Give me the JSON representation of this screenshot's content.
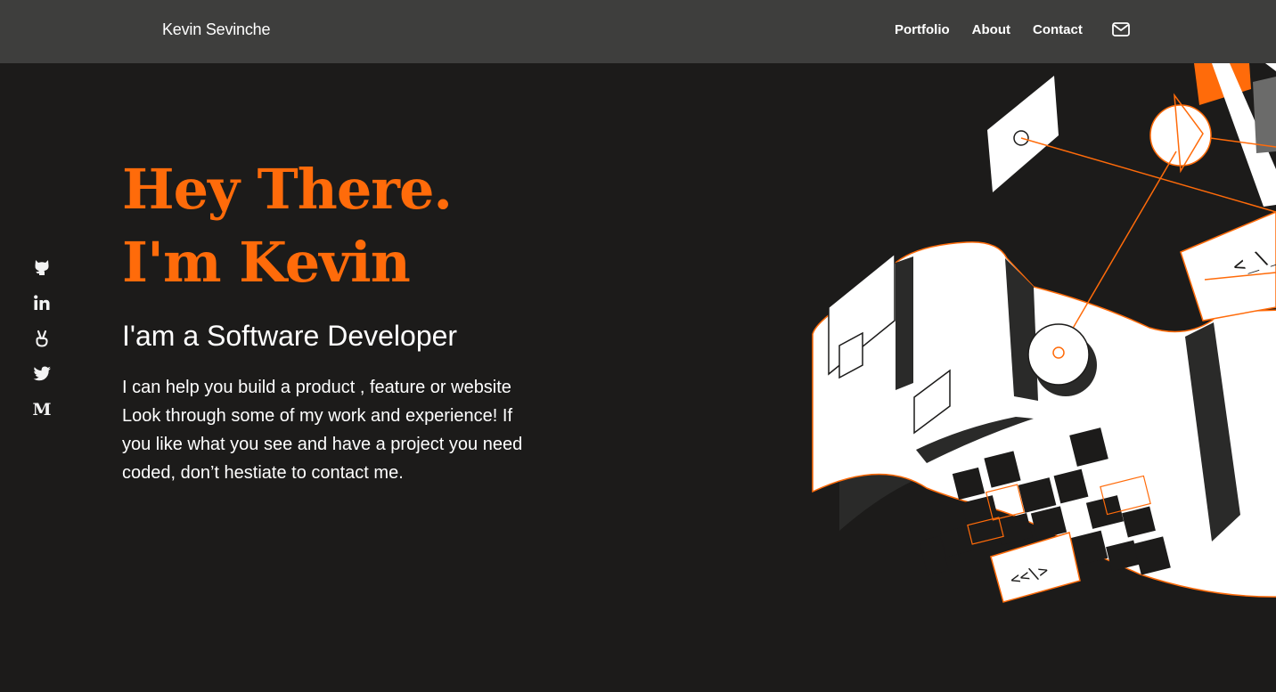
{
  "header": {
    "brand": "Kevin Sevinche",
    "nav": [
      {
        "label": "Portfolio"
      },
      {
        "label": "About"
      },
      {
        "label": "Contact"
      }
    ],
    "mail_icon": "mail-icon"
  },
  "social": [
    {
      "icon": "github-icon"
    },
    {
      "icon": "linkedin-icon"
    },
    {
      "icon": "angellist-icon"
    },
    {
      "icon": "twitter-icon"
    },
    {
      "icon": "medium-icon",
      "glyph": "M"
    }
  ],
  "hero": {
    "title_line1": "Hey There.",
    "title_line2": "I'm Kevin",
    "subtitle": "I'am a Software Developer",
    "body": [
      "I can help you build a product , feature or website",
      "Look through some of my work and experience! If",
      "you like what you see and have a project you need",
      "coded, don’t hestiate to contact me."
    ]
  },
  "illustration": {
    "code_tag_top": "<_\\_",
    "code_tag_bottom": "<<\\>"
  },
  "colors": {
    "accent": "#ff6b0a",
    "background": "#1c1b1a",
    "header": "#3e3e3d",
    "text": "#ffffff"
  }
}
